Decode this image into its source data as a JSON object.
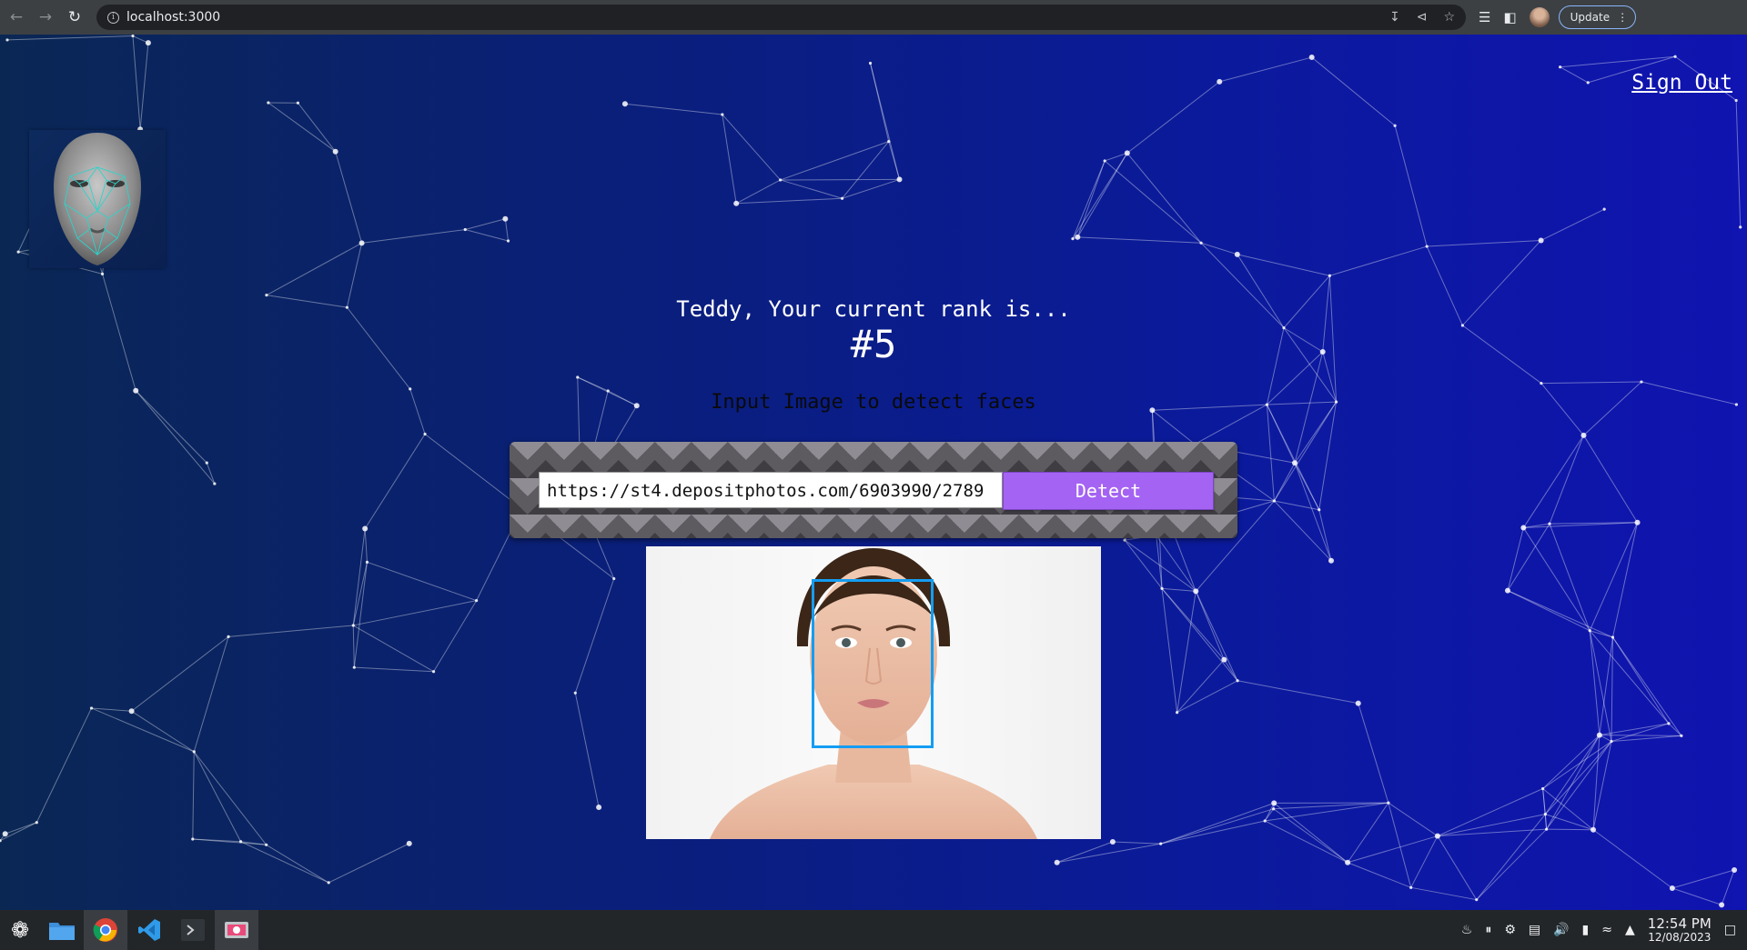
{
  "browser": {
    "url": "localhost:3000",
    "update_label": "Update",
    "icons": {
      "back": "back-arrow-icon",
      "forward": "forward-arrow-icon",
      "reload": "reload-icon",
      "site_info": "info-icon",
      "install": "install-icon",
      "share": "share-icon",
      "bookmark": "star-icon",
      "reading_list": "reading-list-icon",
      "side_panel": "side-panel-icon",
      "menu": "kebab-menu-icon"
    }
  },
  "app": {
    "signout_label": "Sign Out",
    "rank_text": "Teddy, Your current rank is...",
    "rank_value": "#5",
    "prompt": "Input Image to detect faces",
    "image_url_value": "https://st4.depositphotos.com/6903990/2789",
    "detect_label": "Detect",
    "colors": {
      "detect_button": "#a463f2",
      "face_box": "#149df2"
    }
  },
  "taskbar": {
    "apps": [
      "file-manager-icon",
      "chrome-icon",
      "vscode-icon",
      "terminal-icon",
      "screenshot-app-icon"
    ],
    "time": "12:54 PM",
    "date": "12/08/2023"
  }
}
